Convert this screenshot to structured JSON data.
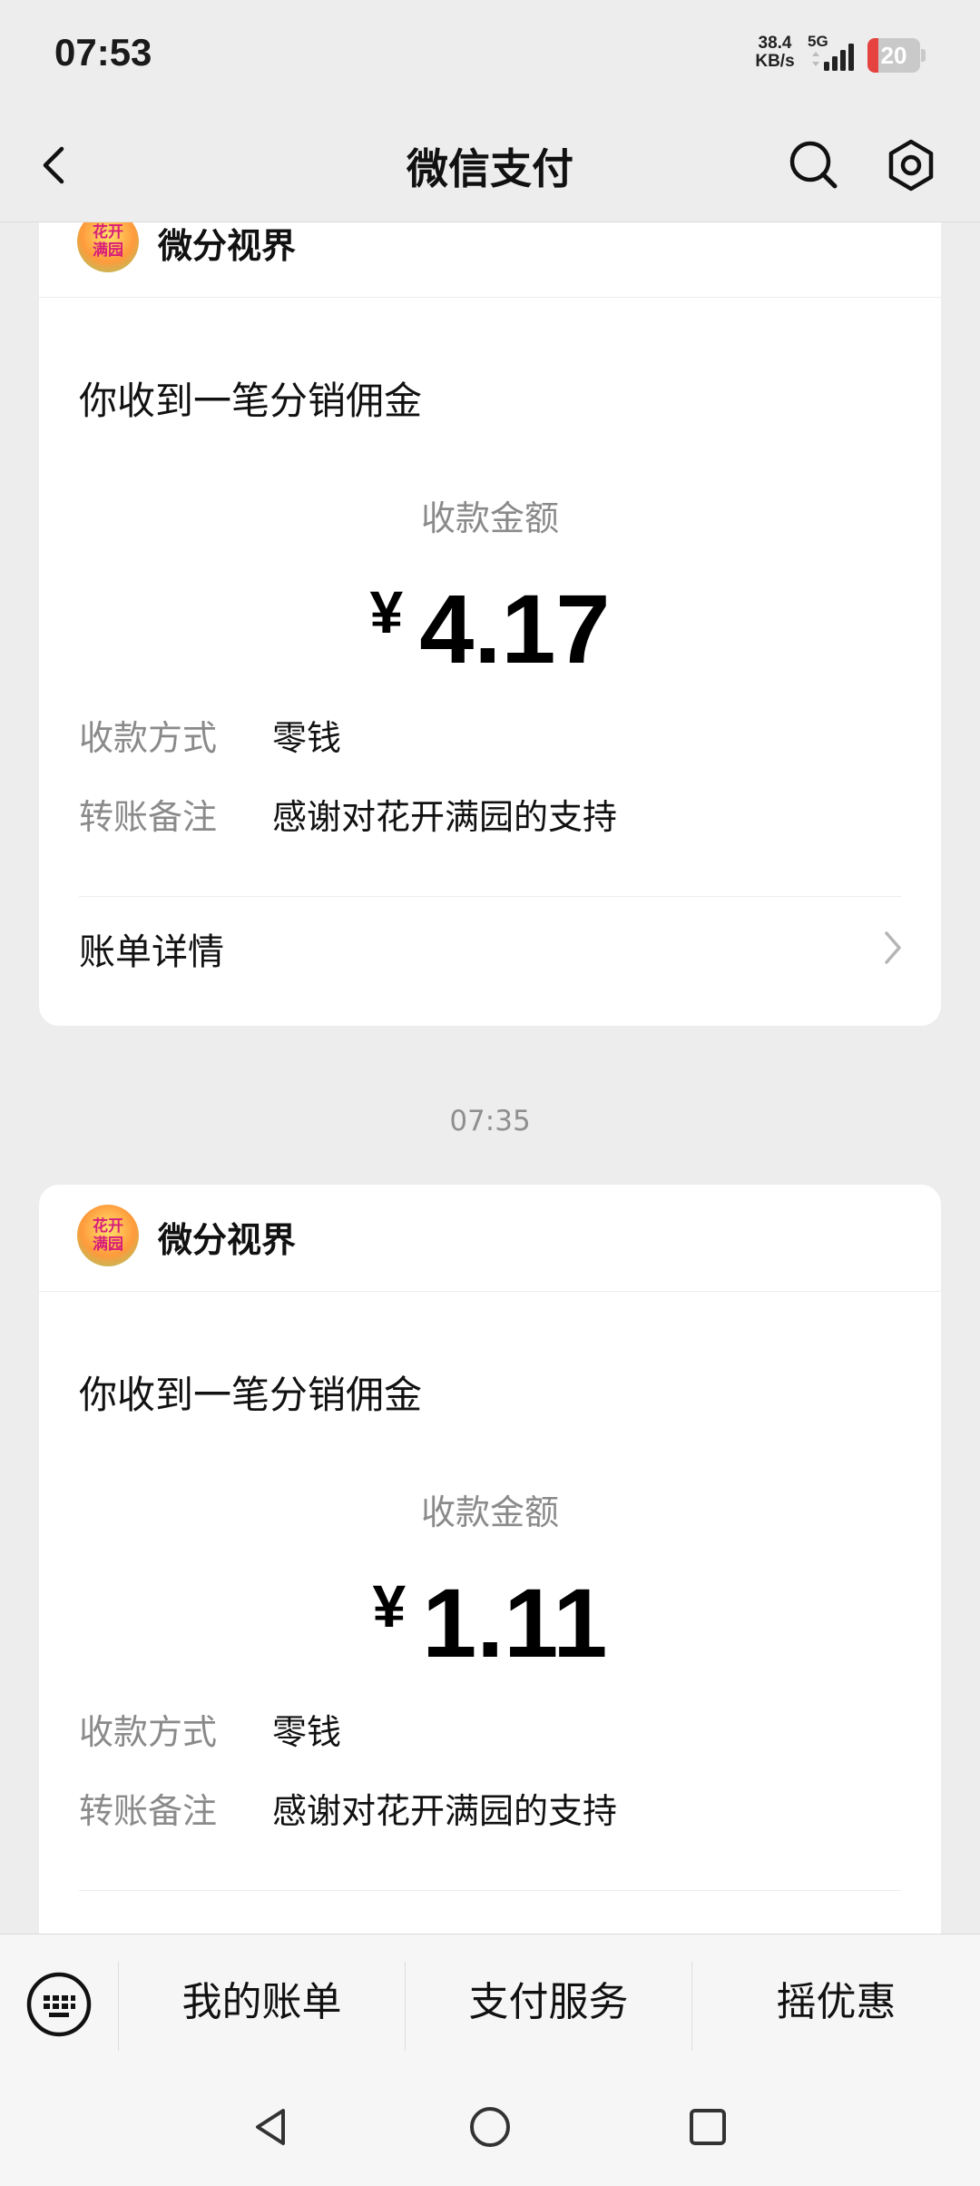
{
  "status_bar": {
    "time": "07:53",
    "net_speed_value": "38.4",
    "net_speed_unit": "KB/s",
    "network": "5G",
    "battery_level": "20",
    "battery_fraction": 0.2,
    "battery_color": "#e64340",
    "icons": [
      "signal-icon",
      "battery-icon"
    ]
  },
  "nav": {
    "title": "微信支付",
    "icons": [
      "back-icon",
      "search-icon",
      "settings-icon"
    ]
  },
  "cards": [
    {
      "merchant_name": "微分视界",
      "logo_text": "花开满园",
      "title": "你收到一笔分销佣金",
      "amount_label": "收款金额",
      "currency": "¥",
      "amount": "4.17",
      "method_label": "收款方式",
      "method_value": "零钱",
      "remark_label": "转账备注",
      "remark_value": "感谢对花开满园的支持",
      "detail_label": "账单详情"
    },
    {
      "merchant_name": "微分视界",
      "logo_text": "花开满园",
      "title": "你收到一笔分销佣金",
      "amount_label": "收款金额",
      "currency": "¥",
      "amount": "1.11",
      "method_label": "收款方式",
      "method_value": "零钱",
      "remark_label": "转账备注",
      "remark_value": "感谢对花开满园的支持"
    }
  ],
  "timestamp": "07:35",
  "bottom_menu": {
    "items": [
      "我的账单",
      "支付服务",
      "摇优惠"
    ],
    "icons": [
      "keyboard-icon"
    ]
  },
  "system_nav": {
    "icons": [
      "back-triangle-icon",
      "home-circle-icon",
      "recents-square-icon"
    ]
  }
}
